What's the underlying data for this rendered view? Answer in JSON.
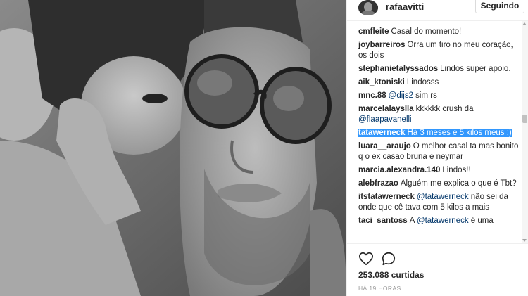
{
  "post": {
    "username": "rafaavitti",
    "follow_label": "Seguindo"
  },
  "comments": [
    {
      "user": "cmfleite",
      "parts": [
        {
          "t": "text",
          "v": "Casal do momento!"
        }
      ]
    },
    {
      "user": "joybarreiros",
      "parts": [
        {
          "t": "text",
          "v": "Orra um tiro no meu coração, os dois"
        }
      ]
    },
    {
      "user": "stephanietalyssados",
      "parts": [
        {
          "t": "text",
          "v": "Lindos super apoio."
        }
      ]
    },
    {
      "user": "aik_ktoniski",
      "parts": [
        {
          "t": "text",
          "v": "Lindosss"
        }
      ]
    },
    {
      "user": "mnc.88",
      "parts": [
        {
          "t": "mention",
          "v": "@dijs2"
        },
        {
          "t": "text",
          "v": " sim rs"
        }
      ]
    },
    {
      "user": "marcelalaysIla",
      "parts": [
        {
          "t": "text",
          "v": "kkkkkk crush da "
        },
        {
          "t": "mention",
          "v": "@flaapavanelli"
        }
      ]
    },
    {
      "user": "tatawerneck",
      "highlighted": true,
      "parts": [
        {
          "t": "text",
          "v": "Há 3 meses e 5 kilos meus :)"
        }
      ]
    },
    {
      "user": "luara__araujo",
      "parts": [
        {
          "t": "text",
          "v": "O melhor casal ta mas bonito q o ex casao bruna e neymar"
        }
      ]
    },
    {
      "user": "marcia.alexandra.140",
      "parts": [
        {
          "t": "text",
          "v": "Lindos!!"
        }
      ]
    },
    {
      "user": "alebfrazao",
      "parts": [
        {
          "t": "text",
          "v": "Alguém me explica o que é Tbt?"
        }
      ]
    },
    {
      "user": "itstatawerneck",
      "parts": [
        {
          "t": "mention",
          "v": "@tatawerneck"
        },
        {
          "t": "text",
          "v": " não sei da onde que cê tava com 5 kilos a mais"
        }
      ]
    },
    {
      "user": "taci_santoss",
      "parts": [
        {
          "t": "text",
          "v": "A "
        },
        {
          "t": "mention",
          "v": "@tatawerneck"
        },
        {
          "t": "text",
          "v": " é uma"
        }
      ]
    }
  ],
  "footer": {
    "likes": "253.088 curtidas",
    "timestamp": "HÁ 19 HORAS"
  },
  "icons": {
    "like": "heart-outline-icon",
    "comment": "speech-bubble-icon"
  },
  "colors": {
    "highlight": "#3297fd",
    "mention": "#003569",
    "text": "#262626",
    "muted": "#999999"
  }
}
